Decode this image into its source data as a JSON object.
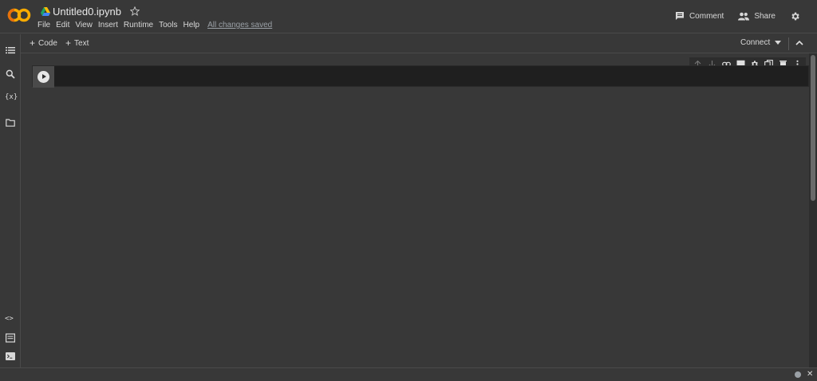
{
  "app": {
    "logo": "colab-logo",
    "colors": {
      "logo_orange": "#f9ab00",
      "background": "#383838",
      "cell_bg": "#1f1f1f"
    }
  },
  "header": {
    "title": "Untitled0.ipynb",
    "menu": [
      "File",
      "Edit",
      "View",
      "Insert",
      "Runtime",
      "Tools",
      "Help"
    ],
    "saved_status": "All changes saved",
    "comment_label": "Comment",
    "share_label": "Share"
  },
  "toolbar": {
    "add_code_label": "Code",
    "add_text_label": "Text",
    "connect_label": "Connect"
  },
  "sidebar": {
    "items": [
      {
        "icon": "table-of-contents-icon"
      },
      {
        "icon": "search-icon"
      },
      {
        "icon": "variables-icon",
        "label": "{x}"
      },
      {
        "icon": "folder-icon"
      }
    ],
    "bottom_items": [
      {
        "icon": "code-snippets-icon",
        "label": "<>"
      },
      {
        "icon": "command-palette-icon"
      },
      {
        "icon": "terminal-icon"
      }
    ]
  },
  "cell": {
    "content": "",
    "toolbar_icons": [
      "move-up-icon",
      "move-down-icon",
      "link-icon",
      "comment-icon",
      "settings-icon",
      "mirror-cell-icon",
      "delete-icon",
      "more-icon"
    ]
  }
}
